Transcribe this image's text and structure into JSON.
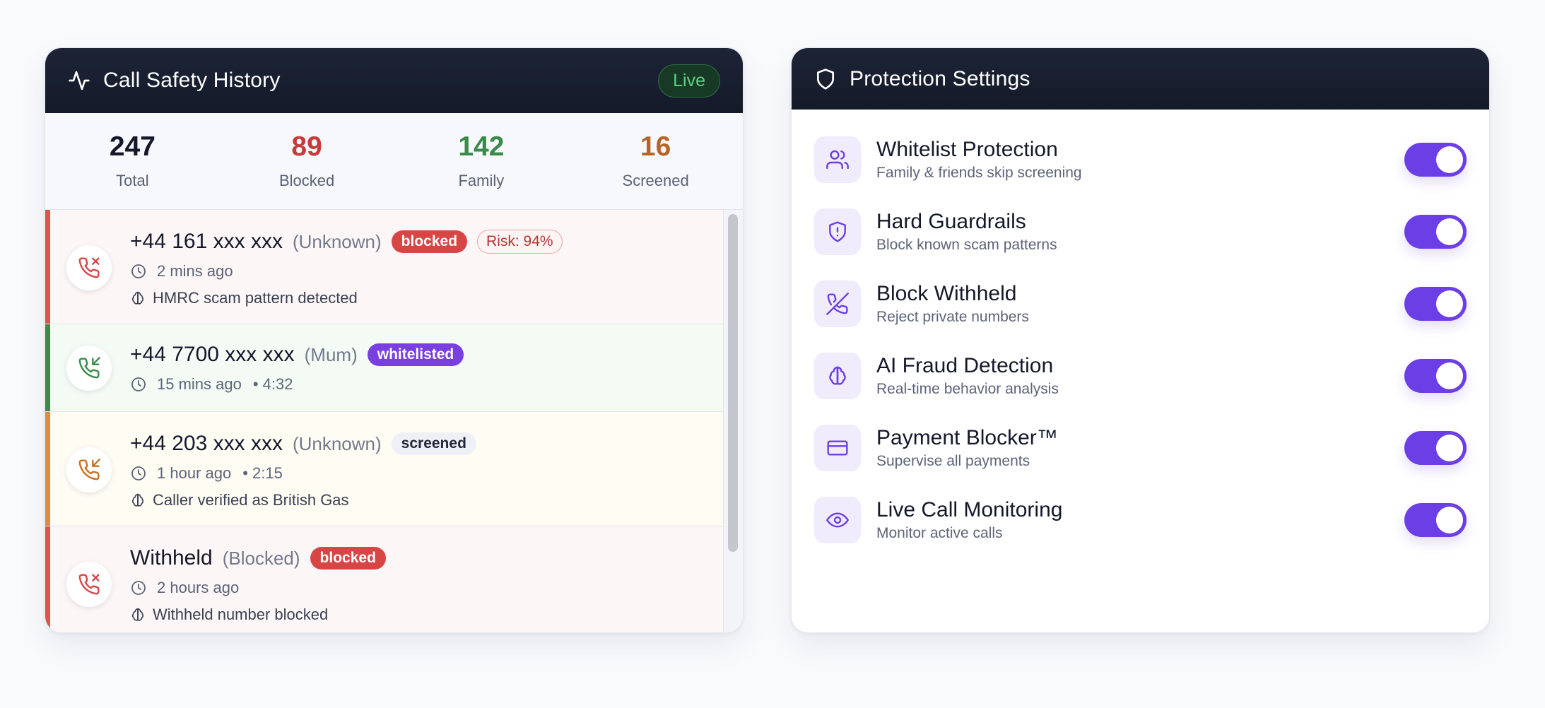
{
  "history": {
    "title": "Call Safety History",
    "live_label": "Live",
    "stats": [
      {
        "value": "247",
        "label": "Total",
        "color": "#14182a"
      },
      {
        "value": "89",
        "label": "Blocked",
        "color": "#c63a3a"
      },
      {
        "value": "142",
        "label": "Family",
        "color": "#3a8a4a"
      },
      {
        "value": "16",
        "label": "Screened",
        "color": "#b86428"
      }
    ],
    "calls": [
      {
        "number": "+44 161 xxx xxx",
        "caller": "(Unknown)",
        "badge": "blocked",
        "risk": "Risk: 94%",
        "time": "2 mins ago",
        "note": "HMRC scam pattern detected",
        "status_color": "#e05252",
        "bg": "#fdf6f6",
        "icon": "phone-x-icon"
      },
      {
        "number": "+44 7700 xxx xxx",
        "caller": "(Mum)",
        "badge": "whitelisted",
        "time": "15 mins ago",
        "duration": "• 4:32",
        "status_color": "#3a8a4a",
        "bg": "#f4fbf5",
        "icon": "phone-incoming-icon"
      },
      {
        "number": "+44 203 xxx xxx",
        "caller": "(Unknown)",
        "badge": "screened",
        "time": "1 hour ago",
        "duration": "• 2:15",
        "note": "Caller verified as British Gas",
        "status_color": "#e08a3a",
        "bg": "#fffcf4",
        "icon": "phone-incoming-icon"
      },
      {
        "number": "Withheld",
        "caller": "(Blocked)",
        "badge": "blocked",
        "time": "2 hours ago",
        "note": "Withheld number blocked",
        "status_color": "#e05252",
        "bg": "#fdf6f6",
        "icon": "phone-x-icon"
      }
    ]
  },
  "settings": {
    "title": "Protection Settings",
    "accent": "#6b3ee6",
    "items": [
      {
        "title": "Whitelist Protection",
        "desc": "Family & friends skip screening",
        "icon": "users-icon",
        "enabled": true
      },
      {
        "title": "Hard Guardrails",
        "desc": "Block known scam patterns",
        "icon": "shield-alert-icon",
        "enabled": true
      },
      {
        "title": "Block Withheld",
        "desc": "Reject private numbers",
        "icon": "phone-off-icon",
        "enabled": true
      },
      {
        "title": "AI Fraud Detection",
        "desc": "Real-time behavior analysis",
        "icon": "brain-icon",
        "enabled": true
      },
      {
        "title": "Payment Blocker™",
        "desc": "Supervise all payments",
        "icon": "credit-card-icon",
        "enabled": true
      },
      {
        "title": "Live Call Monitoring",
        "desc": "Monitor active calls",
        "icon": "eye-icon",
        "enabled": true
      }
    ]
  }
}
